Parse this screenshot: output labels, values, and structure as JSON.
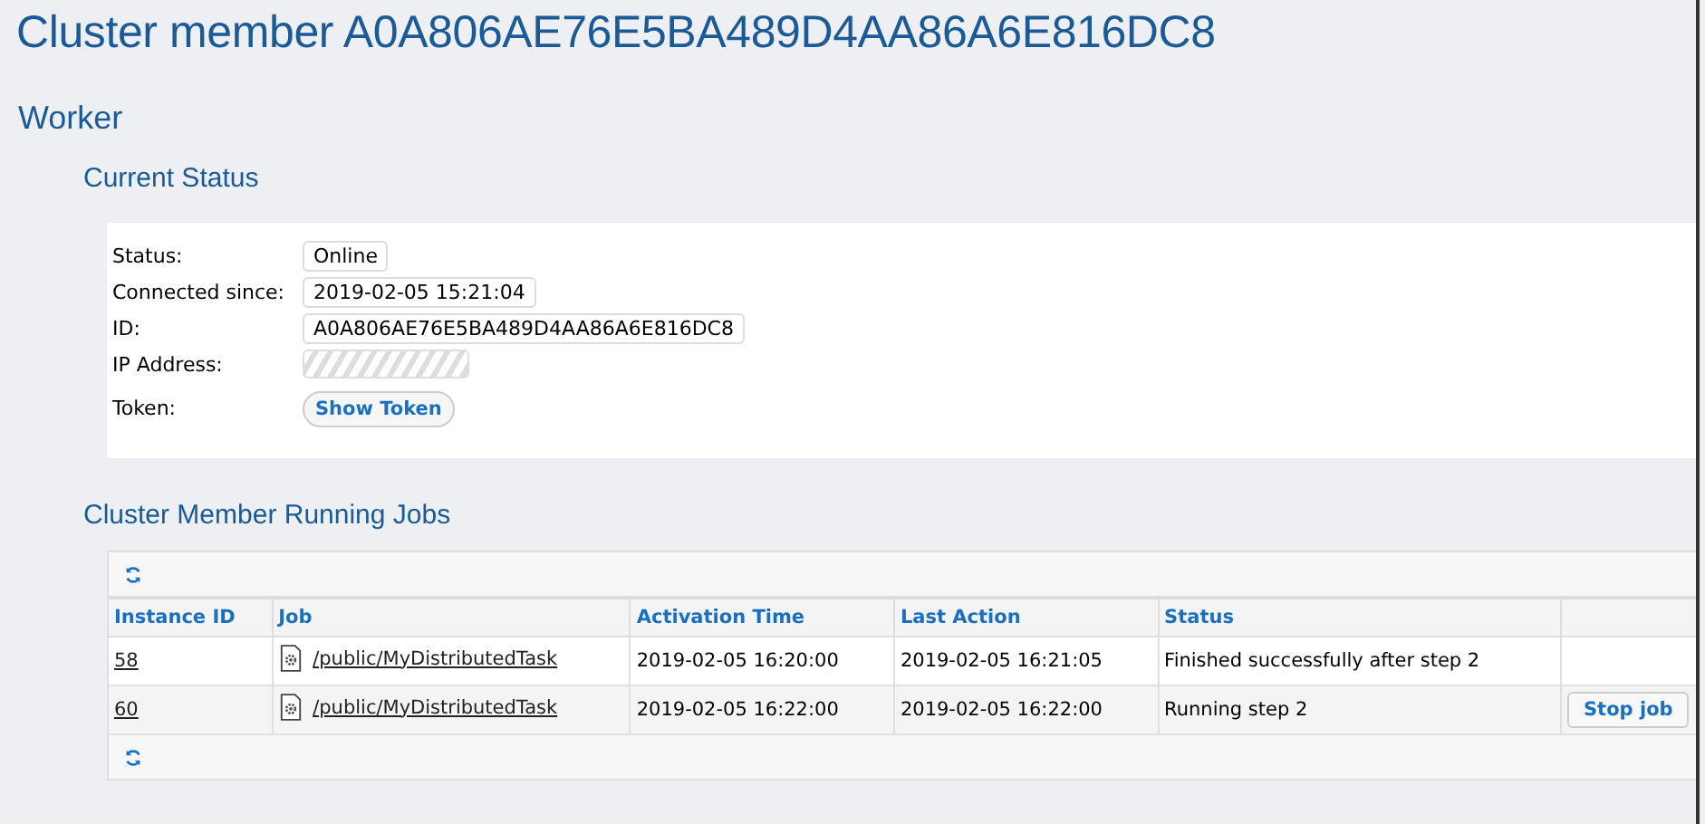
{
  "page_title": "Cluster member A0A806AE76E5BA489D4AA86A6E816DC8",
  "section_title": "Worker",
  "current_status": {
    "heading": "Current Status",
    "fields": [
      {
        "kind": "text",
        "label": "Status:",
        "value": "Online"
      },
      {
        "kind": "text",
        "label": "Connected since:",
        "value": "2019-02-05 15:21:04"
      },
      {
        "kind": "text",
        "label": "ID:",
        "value": "A0A806AE76E5BA489D4AA86A6E816DC8"
      },
      {
        "kind": "redacted",
        "label": "IP Address:"
      },
      {
        "kind": "button",
        "label": "Token:",
        "value": "Show Token"
      }
    ]
  },
  "running_jobs": {
    "heading": "Cluster Member Running Jobs",
    "columns": [
      "Instance ID",
      "Job",
      "Activation Time",
      "Last Action",
      "Status"
    ],
    "rows": [
      {
        "instance_id": "58",
        "job": "/public/MyDistributedTask",
        "activation_time": "2019-02-05 16:20:00",
        "last_action": "2019-02-05 16:21:05",
        "status": "Finished successfully after step 2"
      },
      {
        "instance_id": "60",
        "job": "/public/MyDistributedTask",
        "activation_time": "2019-02-05 16:22:00",
        "last_action": "2019-02-05 16:22:00",
        "status": "Running step 2",
        "action": "Stop job"
      }
    ]
  }
}
